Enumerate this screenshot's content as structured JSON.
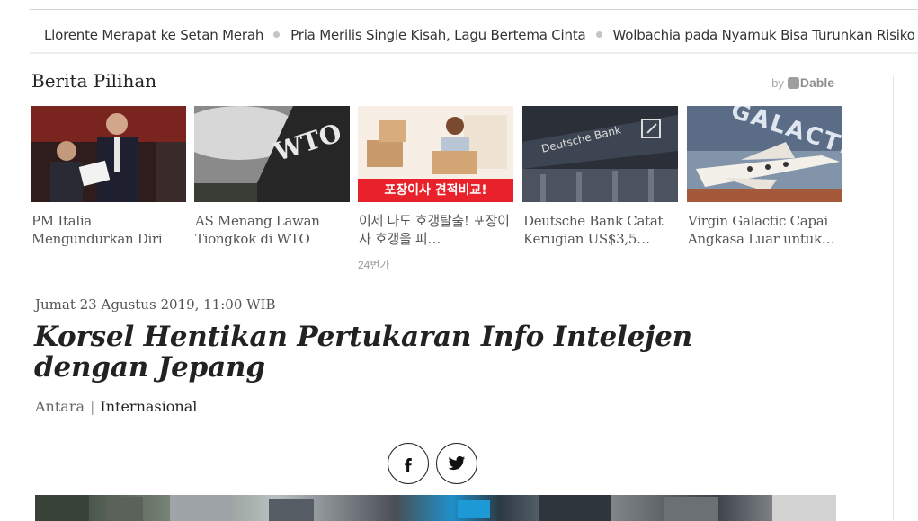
{
  "ticker": {
    "items": [
      "Llorente Merapat ke Setan Merah",
      "Pria Merilis Single Kisah, Lagu Bertema Cinta",
      "Wolbachia pada Nyamuk Bisa Turunkan Risiko"
    ]
  },
  "recommendations": {
    "title": "Berita Pilihan",
    "provider_prefix": "by",
    "provider_name": "Dable",
    "items": [
      {
        "title": "PM Italia Mengundurkan Diri",
        "sub": ""
      },
      {
        "title": "AS Menang Lawan Tiongkok di WTO",
        "sub": "",
        "image_text": "WTO"
      },
      {
        "title": "이제 나도 호갱탈출! 포장이사 호갱을 피…",
        "sub": "24번가",
        "image_text": "포장이사 견적비교!"
      },
      {
        "title": "Deutsche Bank Catat Kerugian US$3,5…",
        "sub": "",
        "image_text": "Deutsche Bank"
      },
      {
        "title": "Virgin Galactic Capai Angkasa Luar untuk…",
        "sub": "",
        "image_text": "GALACTIC"
      }
    ]
  },
  "article": {
    "date": "Jumat 23 Agustus 2019, 11:00 WIB",
    "title": "Korsel Hentikan Pertukaran Info Intelejen dengan Jepang",
    "source": "Antara",
    "separator": "|",
    "category": "Internasional"
  },
  "share": {
    "buttons": [
      "facebook-icon",
      "twitter-icon"
    ]
  },
  "colors": {
    "korean_banner": "#e8212b",
    "ticker_dot": "#c4c4c4",
    "title_text": "#222222"
  }
}
